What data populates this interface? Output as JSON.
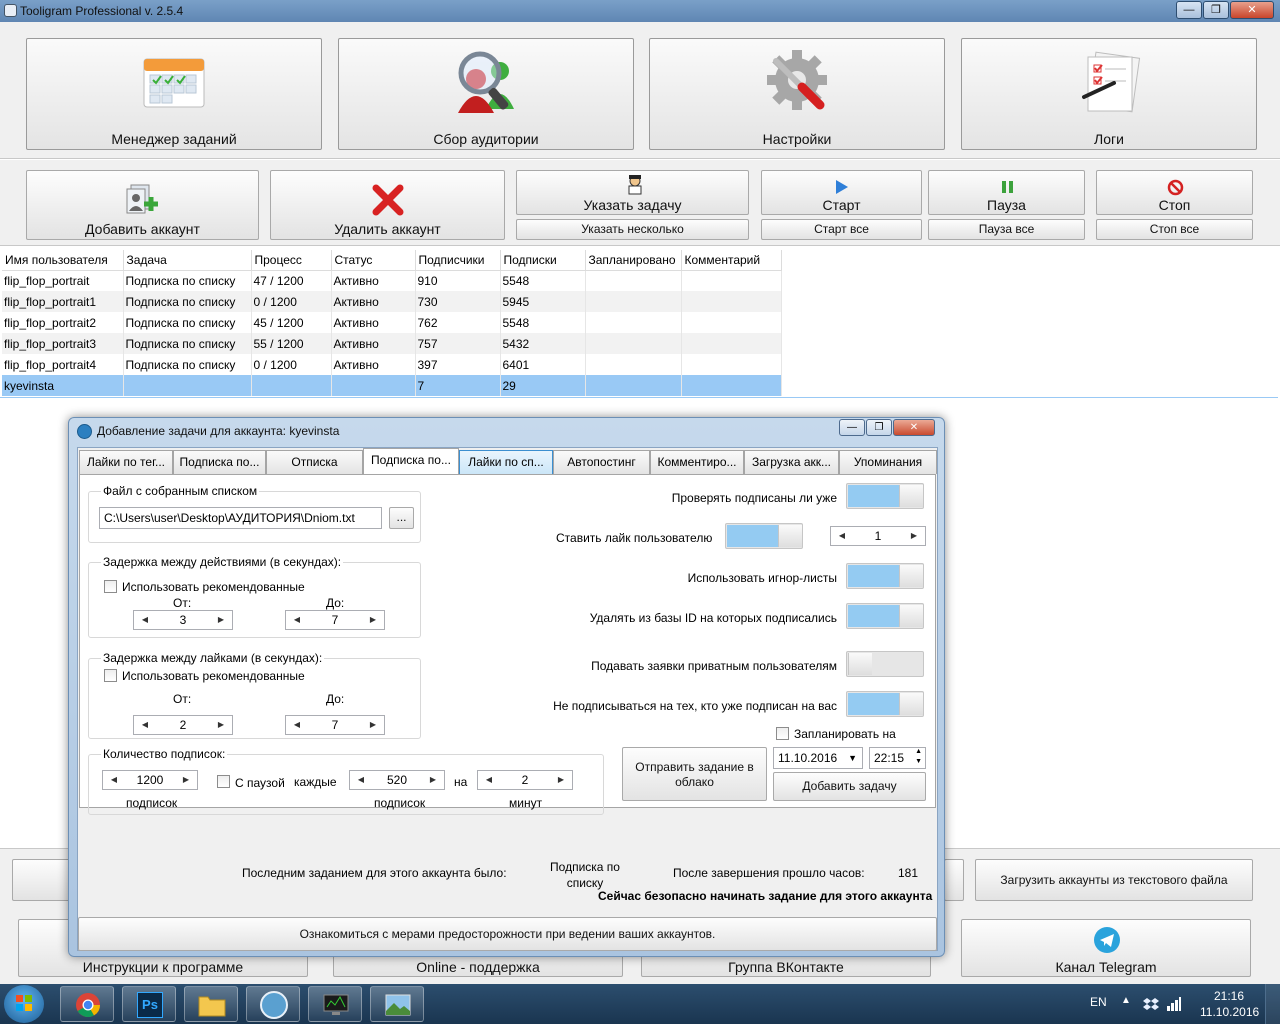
{
  "window": {
    "title": "Tooligram Professional v. 2.5.4",
    "minimize": "—",
    "maximize": "❐",
    "close": "✕"
  },
  "top_buttons": [
    {
      "label": "Менеджер заданий"
    },
    {
      "label": "Сбор аудитории"
    },
    {
      "label": "Настройки"
    },
    {
      "label": "Логи"
    }
  ],
  "account_toolbar": {
    "add_account": "Добавить аккаунт",
    "delete_account": "Удалить аккаунт",
    "set_task": "Указать задачу",
    "set_several": "Указать несколько",
    "start": "Старт",
    "start_all": "Старт все",
    "pause": "Пауза",
    "pause_all": "Пауза все",
    "stop": "Стоп",
    "stop_all": "Стоп все"
  },
  "accounts_table": {
    "columns": [
      "Имя пользователя",
      "Задача",
      "Процесс",
      "Статус",
      "Подписчики",
      "Подписки",
      "Запланировано",
      "Комментарий"
    ],
    "rows": [
      [
        "flip_flop_portrait",
        "Подписка по списку",
        "47 / 1200",
        "Активно",
        "910",
        "5548",
        "",
        ""
      ],
      [
        "flip_flop_portrait1",
        "Подписка по списку",
        "0 / 1200",
        "Активно",
        "730",
        "5945",
        "",
        ""
      ],
      [
        "flip_flop_portrait2",
        "Подписка по списку",
        "45 / 1200",
        "Активно",
        "762",
        "5548",
        "",
        ""
      ],
      [
        "flip_flop_portrait3",
        "Подписка по списку",
        "55 / 1200",
        "Активно",
        "757",
        "5432",
        "",
        ""
      ],
      [
        "flip_flop_portrait4",
        "Подписка по списку",
        "0 / 1200",
        "Активно",
        "397",
        "6401",
        "",
        ""
      ],
      [
        "kyevinsta",
        "",
        "",
        "",
        "7",
        "29",
        "",
        ""
      ]
    ]
  },
  "bottom_buttons": {
    "load_accounts": "Загрузить аккаунты из текстового файла",
    "instructions": "Инструкции к программе",
    "online_support": "Online - поддержка",
    "vk_group": "Группа ВКонтакте",
    "telegram": "Канал Telegram"
  },
  "dialog": {
    "title": "Добавление задачи для аккаунта: kyevinsta",
    "tabs": [
      "Лайки по тег...",
      "Подписка по...",
      "Отписка",
      "Подписка по...",
      "Лайки по сп...",
      "Автопостинг",
      "Комментиро...",
      "Загрузка акк...",
      "Упоминания"
    ],
    "file_group": {
      "label": "Файл с собранным списком",
      "path": "C:\\Users\\user\\Desktop\\АУДИТОРИЯ\\Dniom.txt",
      "browse": "..."
    },
    "action_delay": {
      "label": "Задержка между действиями (в секундах):",
      "use_recommended": "Использовать рекомендованные",
      "from_label": "От:",
      "to_label": "До:",
      "from": "3",
      "to": "7"
    },
    "like_delay": {
      "label": "Задержка между лайками (в секундах):",
      "use_recommended": "Использовать рекомендованные",
      "from_label": "От:",
      "to_label": "До:",
      "from": "2",
      "to": "7"
    },
    "follow_count": {
      "label": "Количество подписок:",
      "count": "1200",
      "count_unit": "подписок",
      "with_pause": "С паузой",
      "each": "каждые",
      "each_value": "520",
      "each_unit": "подписок",
      "on": "на",
      "minutes_value": "2",
      "minutes_unit": "минут"
    },
    "options": {
      "check_following": "Проверять подписаны ли уже",
      "like_user": "Ставить лайк пользователю",
      "like_count": "1",
      "use_ignore": "Использовать игнор-листы",
      "delete_ids": "Удалять из базы ID на которых подписались",
      "private_requests": "Подавать заявки приватным пользователям",
      "skip_followers": "Не подписываться на тех, кто уже подписан на вас"
    },
    "schedule": {
      "label": "Запланировать на",
      "date": "11.10.2016",
      "time": "22:15"
    },
    "send_cloud": "Отправить задание в облако",
    "add_task": "Добавить задачу",
    "last_task_label": "Последним заданием для этого аккаунта было:",
    "last_task_value": "Подписка по списку",
    "hours_label": "После завершения прошло часов:",
    "hours_value": "181",
    "safe_message": "Сейчас безопасно начинать задание для этого аккаунта",
    "safety_link": "Ознакомиться с мерами предосторожности при ведении ваших аккаунтов."
  },
  "taskbar": {
    "lang": "EN",
    "time": "21:16",
    "date": "11.10.2016"
  }
}
